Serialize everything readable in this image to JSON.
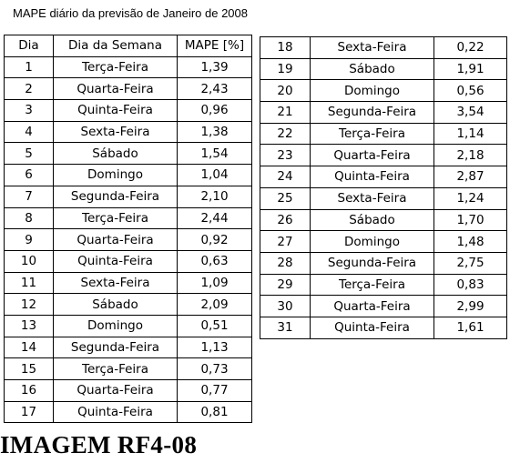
{
  "title": "MAPE diário da previsão de Janeiro de 2008",
  "headers": [
    "Dia",
    "Dia da Semana",
    "MAPE [%]"
  ],
  "rows_left": [
    [
      "1",
      "Terça-Feira",
      "1,39"
    ],
    [
      "2",
      "Quarta-Feira",
      "2,43"
    ],
    [
      "3",
      "Quinta-Feira",
      "0,96"
    ],
    [
      "4",
      "Sexta-Feira",
      "1,38"
    ],
    [
      "5",
      "Sábado",
      "1,54"
    ],
    [
      "6",
      "Domingo",
      "1,04"
    ],
    [
      "7",
      "Segunda-Feira",
      "2,10"
    ],
    [
      "8",
      "Terça-Feira",
      "2,44"
    ],
    [
      "9",
      "Quarta-Feira",
      "0,92"
    ],
    [
      "10",
      "Quinta-Feira",
      "0,63"
    ],
    [
      "11",
      "Sexta-Feira",
      "1,09"
    ],
    [
      "12",
      "Sábado",
      "2,09"
    ],
    [
      "13",
      "Domingo",
      "0,51"
    ],
    [
      "14",
      "Segunda-Feira",
      "1,13"
    ],
    [
      "15",
      "Terça-Feira",
      "0,73"
    ],
    [
      "16",
      "Quarta-Feira",
      "0,77"
    ],
    [
      "17",
      "Quinta-Feira",
      "0,81"
    ]
  ],
  "rows_right": [
    [
      "18",
      "Sexta-Feira",
      "0,22"
    ],
    [
      "19",
      "Sábado",
      "1,91"
    ],
    [
      "20",
      "Domingo",
      "0,56"
    ],
    [
      "21",
      "Segunda-Feira",
      "3,54"
    ],
    [
      "22",
      "Terça-Feira",
      "1,14"
    ],
    [
      "23",
      "Quarta-Feira",
      "2,18"
    ],
    [
      "24",
      "Quinta-Feira",
      "2,87"
    ],
    [
      "25",
      "Sexta-Feira",
      "1,24"
    ],
    [
      "26",
      "Sábado",
      "1,70"
    ],
    [
      "27",
      "Domingo",
      "1,48"
    ],
    [
      "28",
      "Segunda-Feira",
      "2,75"
    ],
    [
      "29",
      "Terça-Feira",
      "0,83"
    ],
    [
      "30",
      "Quarta-Feira",
      "2,99"
    ],
    [
      "31",
      "Quinta-Feira",
      "1,61"
    ]
  ],
  "caption": "IMAGEM RF4-08"
}
